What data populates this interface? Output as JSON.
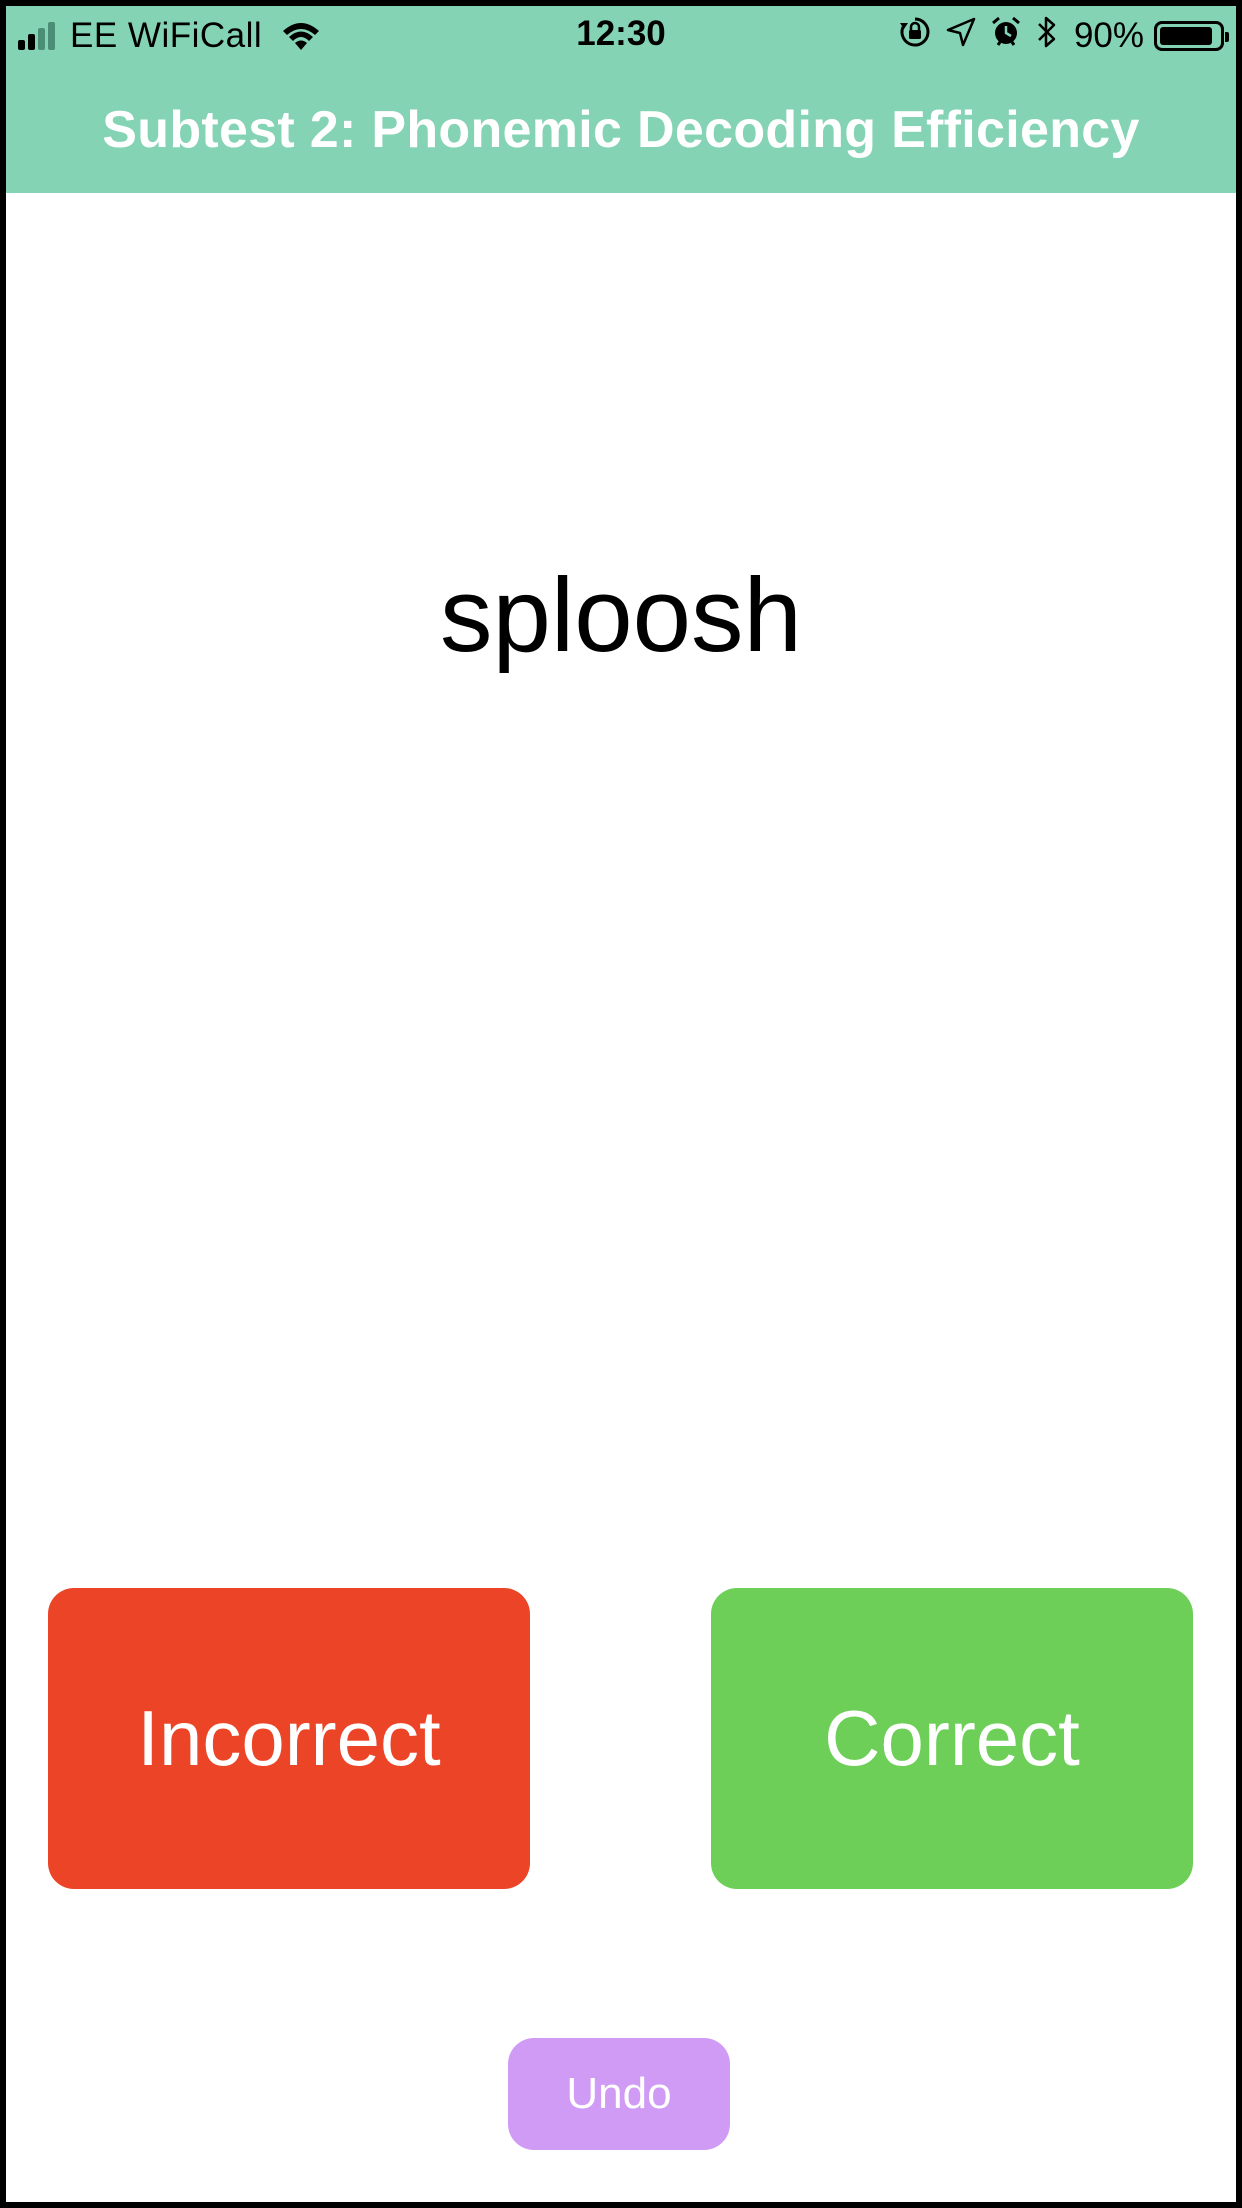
{
  "status_bar": {
    "carrier": "EE WiFiCall",
    "time": "12:30",
    "battery_percent": "90%",
    "battery_level": 0.9,
    "signal_strength": 2,
    "signal_bars": 4,
    "icons": [
      "signal-icon",
      "wifi-icon",
      "orientation-lock-icon",
      "location-arrow-icon",
      "alarm-icon",
      "bluetooth-icon",
      "battery-icon"
    ]
  },
  "header": {
    "title": "Subtest 2: Phonemic Decoding Efficiency"
  },
  "main": {
    "word": "sploosh"
  },
  "actions": {
    "incorrect_label": "Incorrect",
    "correct_label": "Correct",
    "undo_label": "Undo"
  },
  "colors": {
    "header_bg": "#84d3b5",
    "incorrect": "#ec4427",
    "correct": "#6dcf58",
    "undo": "#d09bf5",
    "border": "#000000"
  }
}
